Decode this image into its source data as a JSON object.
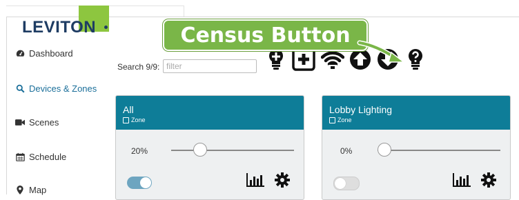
{
  "brand": {
    "logo_text": "LEVITON",
    "logo_accent": "#8dc63f",
    "logo_color": "#1e3c63"
  },
  "sidebar": {
    "items": [
      {
        "label": "Dashboard",
        "icon": "dashboard-icon",
        "active": false
      },
      {
        "label": "Devices & Zones",
        "icon": "search-icon",
        "active": true
      },
      {
        "label": "Scenes",
        "icon": "video-camera-icon",
        "active": false
      },
      {
        "label": "Schedule",
        "icon": "calendar-icon",
        "active": false
      },
      {
        "label": "Map",
        "icon": "map-marker-icon",
        "active": false
      }
    ]
  },
  "search": {
    "label": "Search 9/9:",
    "placeholder": "filter",
    "value": ""
  },
  "callout": {
    "text": "Census Button",
    "color": "#7ab648"
  },
  "toolbar": {
    "icons": [
      "add-bulb-icon",
      "add-zone-icon",
      "wifi-icon",
      "upload-icon",
      "download-icon",
      "census-bulb-icon"
    ]
  },
  "zones": [
    {
      "title": "All",
      "subtitle": "Zone",
      "level_text": "20%",
      "level": 0.2,
      "on": true
    },
    {
      "title": "Lobby Lighting",
      "subtitle": "Zone",
      "level_text": "0%",
      "level": 0.0,
      "on": false
    }
  ],
  "colors": {
    "header": "#0e7d98",
    "toggle_on": "#6da5c0",
    "toggle_off": "#dedede",
    "accent_text": "#1b6f9a"
  }
}
